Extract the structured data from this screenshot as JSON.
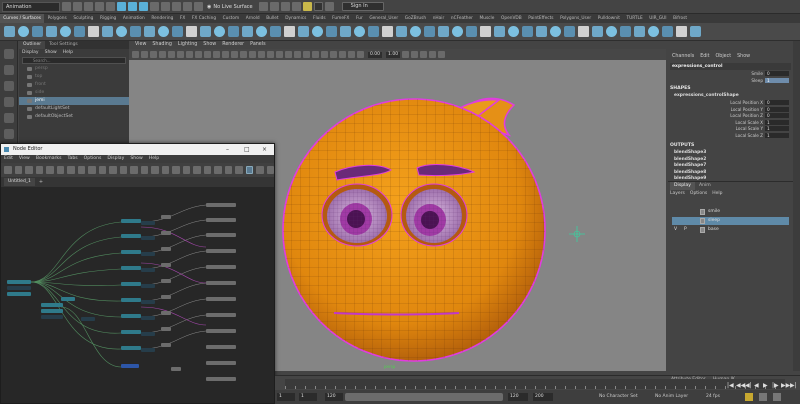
{
  "status_line": {
    "mode": "Animation",
    "live_surface": "No Live Surface",
    "sign_in": "Sign In"
  },
  "shelf_tabs": [
    "Curves / Surfaces",
    "Polygons",
    "Sculpting",
    "Rigging",
    "Animation",
    "Rendering",
    "FX",
    "FX Caching",
    "Custom",
    "Arnold",
    "Bullet",
    "Dynamics",
    "Fluids",
    "FumeFX",
    "Fur",
    "General_User",
    "GoZBrush",
    "nHair",
    "nCFeather",
    "Muscle",
    "OpenVDB",
    "PaintEffects",
    "Polygons_User",
    "Pulldownit",
    "TURTLE",
    "UIR_GUI",
    "Bifrost"
  ],
  "outliner": {
    "tabs": [
      "Outliner",
      "Tool Settings"
    ],
    "menu": [
      "Display",
      "Show",
      "Help"
    ],
    "search_placeholder": "Search...",
    "items": [
      {
        "label": "persp",
        "dim": true
      },
      {
        "label": "top",
        "dim": true
      },
      {
        "label": "front",
        "dim": true
      },
      {
        "label": "side",
        "dim": true
      },
      {
        "label": "jemi",
        "selected": true
      },
      {
        "label": "defaultLightSet"
      },
      {
        "label": "defaultObjectSet"
      }
    ]
  },
  "viewport": {
    "menu": [
      "View",
      "Shading",
      "Lighting",
      "Show",
      "Renderer",
      "Panels"
    ],
    "field_a": "0.00",
    "field_b": "1.00",
    "camera_label": "persp"
  },
  "node_editor": {
    "title": "Node Editor",
    "menu": [
      "Edit",
      "View",
      "Bookmarks",
      "Tabs",
      "Options",
      "Display",
      "Show",
      "Help"
    ],
    "tab": "Untitled_1",
    "tab_add": "+"
  },
  "channel_box": {
    "menu": [
      "Channels",
      "Edit",
      "Object",
      "Show"
    ],
    "object": "expressions_control",
    "channels": [
      {
        "label": "Smile",
        "value": "0"
      },
      {
        "label": "Sleep",
        "value": "1",
        "highlight": true
      }
    ],
    "shapes_header": "SHAPES",
    "shape_name": "expressions_controlShape",
    "shape_channels": [
      {
        "label": "Local Position X",
        "value": "0"
      },
      {
        "label": "Local Position Y",
        "value": "0"
      },
      {
        "label": "Local Position Z",
        "value": "0"
      },
      {
        "label": "Local Scale X",
        "value": "1"
      },
      {
        "label": "Local Scale Y",
        "value": "1"
      },
      {
        "label": "Local Scale Z",
        "value": "1"
      }
    ],
    "outputs_header": "OUTPUTS",
    "outputs": [
      "blendShape3",
      "blendShape2",
      "blendShape7",
      "blendShape8",
      "blendShape9"
    ]
  },
  "layers": {
    "tabs": [
      "Display",
      "Anim"
    ],
    "menu": [
      "Layers",
      "Options",
      "Help"
    ],
    "rows": [
      {
        "v": "",
        "p": "",
        "name": "smile",
        "selected": false
      },
      {
        "v": "",
        "p": "",
        "name": "sleep",
        "selected": true
      },
      {
        "v": "V",
        "p": "P",
        "name": "base",
        "selected": false
      }
    ]
  },
  "time_slider": {
    "attribute_editor": "Attribute Editor",
    "human_ik": "Human IK",
    "playback_icons": [
      "|◀",
      "◀◀",
      "◀|",
      "◀",
      "▶",
      "|▶",
      "▶▶",
      "▶|"
    ]
  },
  "range_slider": {
    "start": "1",
    "start_inner": "1",
    "end_inner": "120",
    "end": "120",
    "end_max": "200",
    "character_set": "No Character Set",
    "anim_layer": "No Anim Layer",
    "fps": "24 fps"
  }
}
